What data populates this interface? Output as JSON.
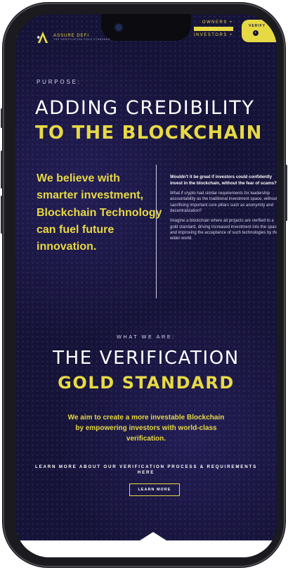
{
  "brand": {
    "name": "ASSURE DEFI",
    "tagline": "THE VERIFICATION GOLD STANDARD",
    "accent": "#e7d944",
    "background": "#161338"
  },
  "nav": {
    "owners": "OWNERS +",
    "investors": "INVESTORS +",
    "verify": "VERIFY"
  },
  "purpose": {
    "eyebrow": "PURPOSE:",
    "title_line1": "ADDING CREDIBILITY",
    "title_line2": "TO THE BLOCKCHAIN",
    "statement": "We believe with smarter investment, Blockchain Technology can fuel future innovation.",
    "question": "Wouldn't it be great if investors could confidently invest in the blockchain, without the fear of scams?",
    "para1": "What if crypto had similar requirements for leadership accountability as the traditional investment space, without sacrificing important core pillars such as anonymity and decentralization?",
    "para2": "Imagine a blockchain where all projects are verified to a gold standard, driving increased investment into the space, and improving the acceptance of such technologies by the wider world."
  },
  "what_we_are": {
    "eyebrow": "WHAT WE ARE:",
    "title_line1": "THE VERIFICATION",
    "title_line2": "GOLD STANDARD",
    "aim": "We aim to create a more investable Blockchain by empowering investors with world-class verification.",
    "learn_more_text": "LEARN MORE ABOUT OUR VERIFICATION PROCESS & REQUIREMENTS HERE",
    "learn_more_button": "LEARN MORE"
  },
  "icons": {
    "logo": "assure-defi-logo-icon",
    "verify_arrow": "arrow-right-icon"
  }
}
